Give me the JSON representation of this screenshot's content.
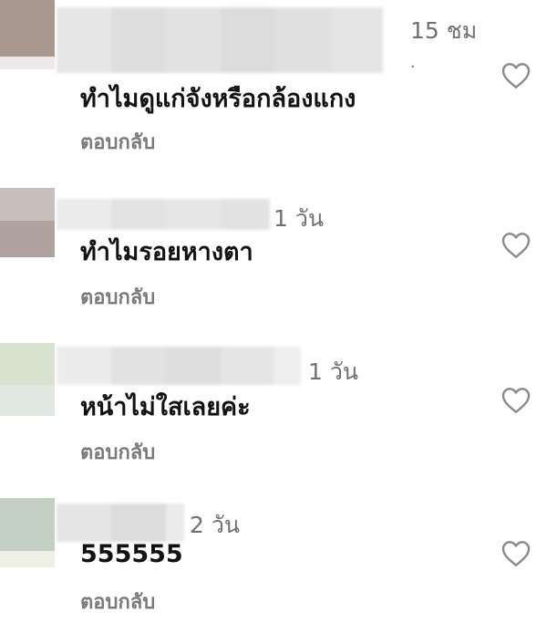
{
  "comments": [
    {
      "time": "15 ชม",
      "time_suffix": ".",
      "text": "ทำไมดูแก่จังหรือกล้องแกง",
      "reply_label": "ตอบกลับ",
      "avatar_colors": [
        "#a89890",
        "#ece9e8"
      ]
    },
    {
      "time": "1 วัน",
      "text": "ทำไมรอยหางตา",
      "reply_label": "ตอบกลับ",
      "avatar_colors": [
        "#c8bebb",
        "#b0a29e"
      ]
    },
    {
      "time": "1 วัน",
      "text": "หน้าไม่ใสเลยค่ะ",
      "reply_label": "ตอบกลับ",
      "avatar_colors": [
        "#d9e1cf",
        "#dfe7e0"
      ]
    },
    {
      "time": "2 วัน",
      "text": "555555",
      "reply_label": "ตอบกลับ",
      "avatar_colors": [
        "#c4cfc3",
        "#eef0e6"
      ]
    }
  ],
  "colors": {
    "time_text": "#707070",
    "reply_text": "#7a7a7a",
    "heart_stroke": "#8a8a8a"
  },
  "icons": {
    "like": "heart-outline-icon"
  }
}
